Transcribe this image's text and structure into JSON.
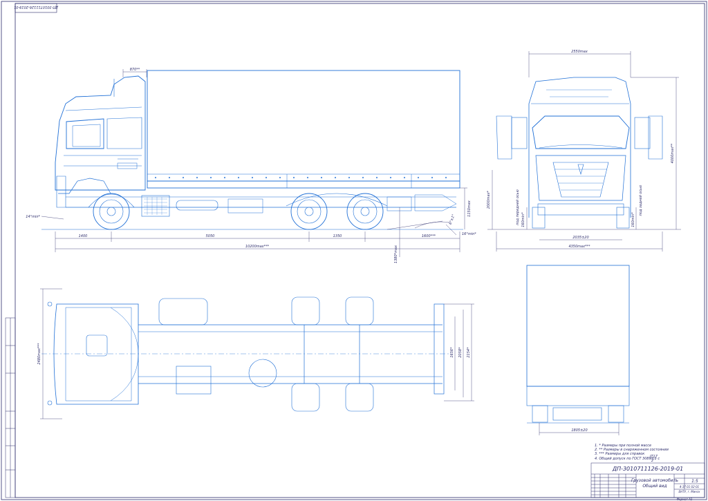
{
  "drawing": {
    "designation": "ДП-3010711126-2019-01",
    "designation_rotated": "ДП-3010711126-2019-01",
    "title_line1": "Грузовой автомобиль",
    "title_line2": "Общий вид",
    "sheet_number": "1:5",
    "org_line1": "4-37 01 02-01",
    "org_line2": "БНТУ, г. Минск",
    "format": "Формат A1"
  },
  "notes": [
    "1. * Размеры при полной массе",
    "2. ** Размеры в снаряженном состоянии",
    "3. *** Размеры для справок",
    "4. Общий допуск по ГОСТ 30893.1 c"
  ],
  "notes_fraction": {
    "top": "IT17",
    "bottom": "2"
  },
  "side_view": {
    "dims": {
      "d1400": "1400",
      "d5050": "5050",
      "d1350": "1350",
      "d1600": "1600***",
      "d10200": "10200max***",
      "d870": "870**",
      "d1380": "1380*max",
      "d14": "14°min*",
      "d16": "16°min*",
      "d1150": "1150max",
      "angle6": "6°±1°"
    }
  },
  "front_view": {
    "dims": {
      "w2550": "2550max",
      "h4000": "4000max**",
      "h2000": "2000max*",
      "t2035": "2035±20",
      "w4350": "4350max***",
      "c160": "160min*",
      "c160b": "160min*",
      "front_axle": "под передней осью",
      "rear_axle": "под задней осью"
    }
  },
  "top_view": {
    "dims": {
      "w2480": "2480max***",
      "d2154": "2154*",
      "d2058": "2058*",
      "d1656": "1656*"
    }
  },
  "rear_view": {
    "dims": {
      "t1805": "1805±20"
    }
  },
  "side_strip": {
    "labels": [
      "Перв. примен.",
      "Справ. №",
      "Подп. и дата",
      "Инв. № дубл.",
      "Взам. инв. №",
      "Подп. и дата",
      "Инв. № подл."
    ]
  },
  "colors": {
    "line": "#1f6fd6",
    "frame": "#2b2b6b",
    "dim": "#2b2b6b"
  }
}
